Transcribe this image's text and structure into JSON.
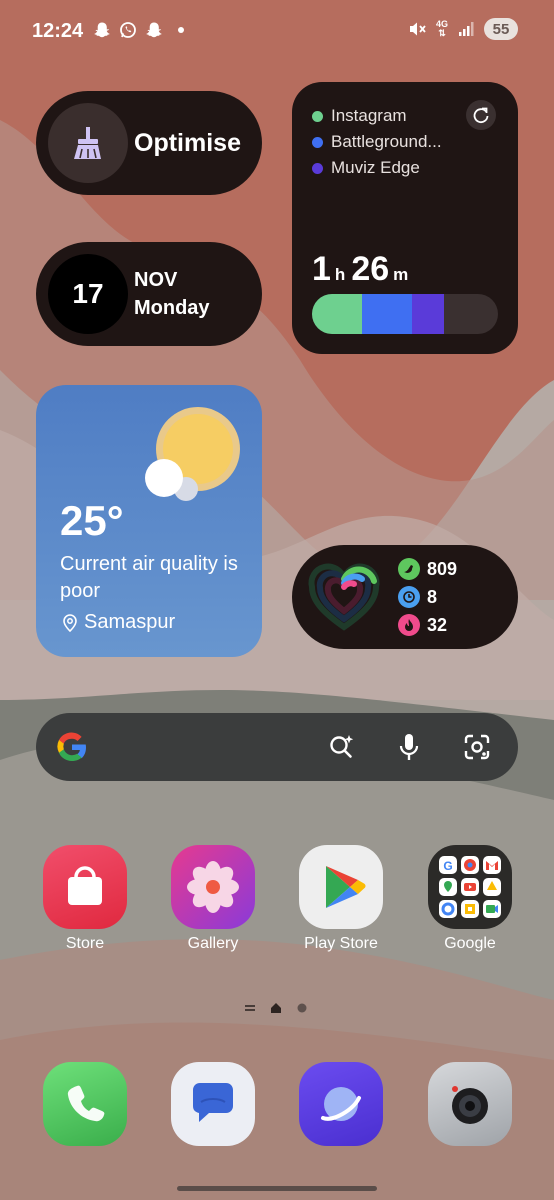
{
  "status_bar": {
    "time": "12:24",
    "notification_icons": [
      "snapchat-icon",
      "whatsapp-icon",
      "snapchat-icon"
    ],
    "network": "4G",
    "battery": "55"
  },
  "optimise_widget": {
    "label": "Optimise",
    "icon": "broom-icon"
  },
  "date_widget": {
    "day": "17",
    "month": "NOV",
    "weekday": "Monday"
  },
  "usage_widget": {
    "apps": [
      {
        "name": "Instagram",
        "color": "#6ed08f",
        "share": 0.27
      },
      {
        "name": "Battleground...",
        "color": "#3f6ff2",
        "share": 0.27
      },
      {
        "name": "Muviz Edge",
        "color": "#5a3bd9",
        "share": 0.17
      }
    ],
    "hours": "1",
    "hours_unit": "h",
    "minutes": "26",
    "minutes_unit": "m"
  },
  "weather_widget": {
    "temperature": "25°",
    "description": "Current air quality is poor",
    "location": "Samaspur"
  },
  "fitness_widget": {
    "steps": "809",
    "active_minutes": "8",
    "calories": "32",
    "colors": {
      "steps": "#5ec75e",
      "minutes": "#4a9ff0",
      "calories": "#f04b8c"
    }
  },
  "search_bar": {
    "logo": "google-g-icon"
  },
  "apps": [
    {
      "name": "Store"
    },
    {
      "name": "Gallery"
    },
    {
      "name": "Play Store"
    },
    {
      "name": "Google"
    }
  ],
  "dock": [
    "phone-icon",
    "messages-icon",
    "internet-icon",
    "camera-icon"
  ]
}
